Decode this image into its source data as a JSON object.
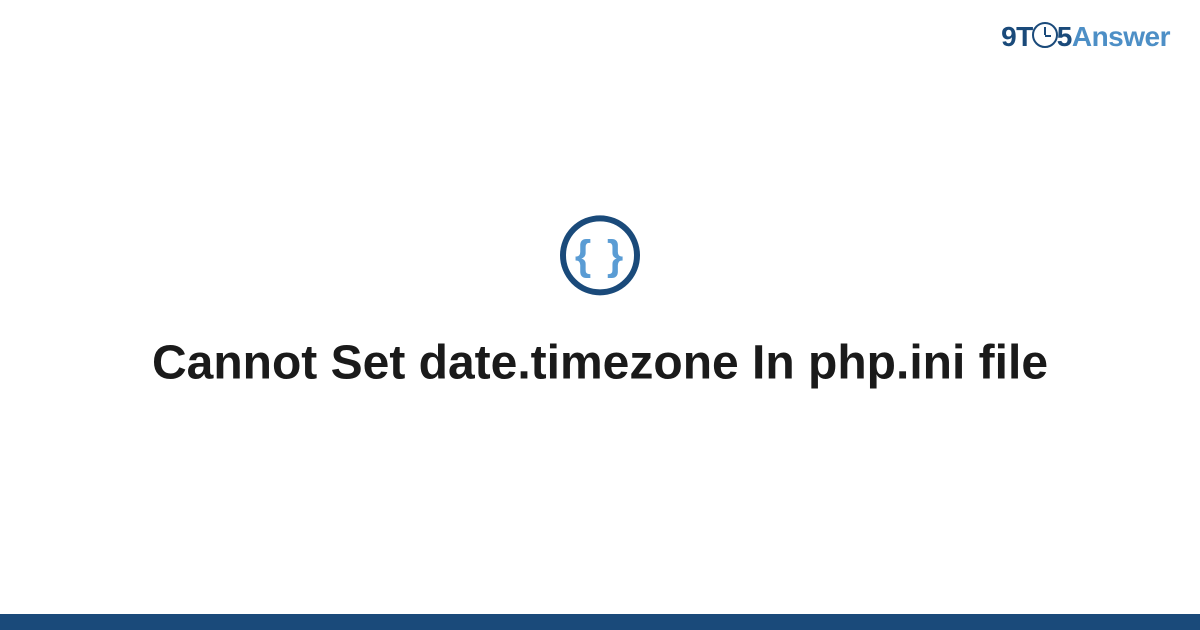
{
  "logo": {
    "part1": "9T",
    "part2": "5",
    "part3": "Answer"
  },
  "icon": {
    "braces": "{ }",
    "semantic": "code-braces-icon"
  },
  "title": "Cannot Set date.timezone In php.ini file",
  "colors": {
    "dark_blue": "#1a4a7a",
    "light_blue": "#5a9cd4",
    "mid_blue": "#4d8fc6",
    "text": "#1a1a1a",
    "background": "#ffffff"
  }
}
